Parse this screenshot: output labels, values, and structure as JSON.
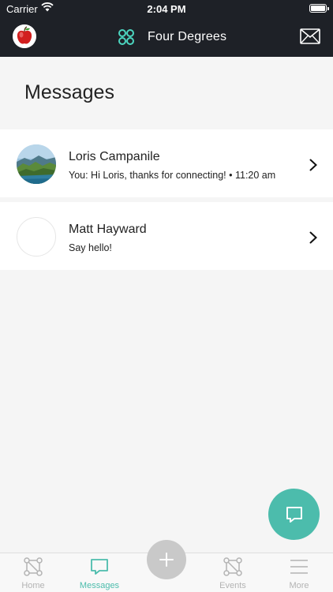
{
  "status_bar": {
    "carrier": "Carrier",
    "time": "2:04 PM"
  },
  "header": {
    "title": "Four Degrees",
    "icons": [
      "apple-avatar-icon",
      "four-degrees-logo-icon",
      "mail-icon"
    ]
  },
  "page": {
    "title": "Messages"
  },
  "conversations": [
    {
      "name": "Loris Campanile",
      "preview": "You: Hi Loris, thanks for connecting!  • 11:20 am",
      "avatar": "landscape-photo"
    },
    {
      "name": "Matt Hayward",
      "preview": "Say hello!",
      "avatar": "empty"
    }
  ],
  "tabbar": {
    "items": [
      {
        "label": "Home",
        "icon": "network-icon"
      },
      {
        "label": "Messages",
        "icon": "chat-bubble-icon",
        "active": true
      },
      {
        "label": "Events",
        "icon": "network-icon"
      },
      {
        "label": "More",
        "icon": "hamburger-icon"
      }
    ],
    "add_icon": "plus-icon"
  },
  "colors": {
    "accent": "#4cbcac",
    "header_bg": "#1e2127",
    "page_bg": "#f5f5f5"
  }
}
